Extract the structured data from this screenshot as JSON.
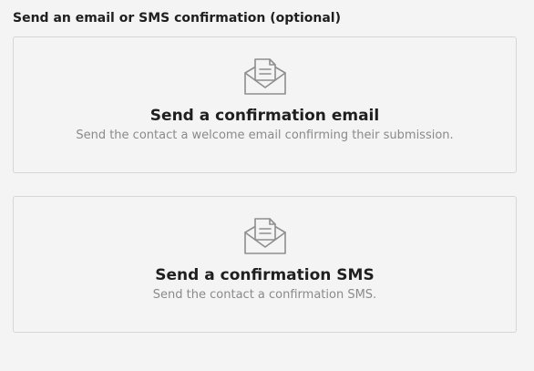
{
  "heading": "Send an email or SMS confirmation (optional)",
  "options": [
    {
      "icon": "envelope-letter-icon",
      "title": "Send a confirmation email",
      "description": "Send the contact a welcome email confirming their submission."
    },
    {
      "icon": "envelope-letter-icon",
      "title": "Send a confirmation SMS",
      "description": "Send the contact a confirmation SMS."
    }
  ],
  "colors": {
    "background": "#f4f4f4",
    "border": "#d6d6d6",
    "title": "#1f1f1f",
    "description": "#8a8a8a",
    "icon": "#8e8e8e"
  }
}
